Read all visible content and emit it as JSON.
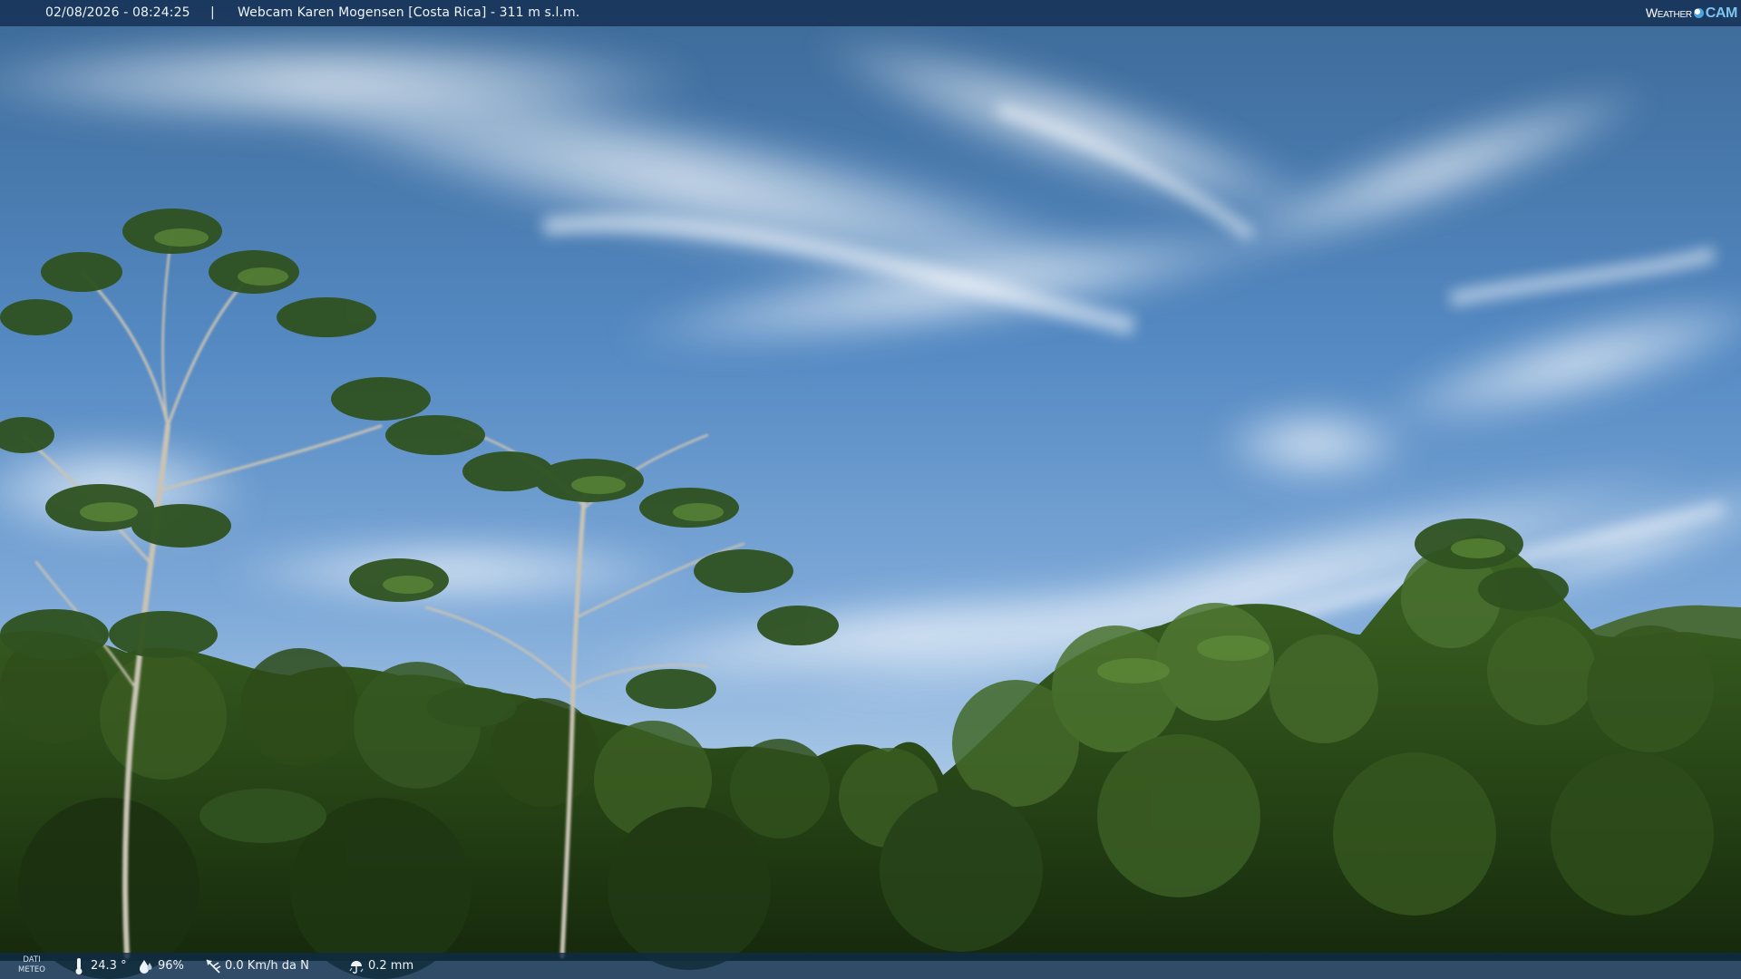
{
  "overlay": {
    "datetime": "02/08/2026 - 08:24:25",
    "separator": "|",
    "title": "Webcam Karen Mogensen [Costa Rica]  - 311 m s.l.m.",
    "logo": {
      "part_a": "Weather",
      "part_b": "CAM"
    }
  },
  "weather": {
    "label_line1": "DATI",
    "label_line2": "METEO",
    "temperature": "24.3 °",
    "humidity": "96%",
    "wind": "0.0 Km/h da N",
    "rain": "0.2 mm",
    "icons": [
      "thermometer-icon",
      "humidity-icon",
      "wind-icon",
      "rain-icon"
    ]
  },
  "colors": {
    "sky_top": "#3f6d9c",
    "sky_mid": "#5b8fc9",
    "sky_horizon": "#9ec1e2",
    "foliage_dark": "#1d3612",
    "foliage_mid": "#3a5f22",
    "foliage_light": "#5d8a34",
    "overlay_bar": "#122c4e"
  }
}
